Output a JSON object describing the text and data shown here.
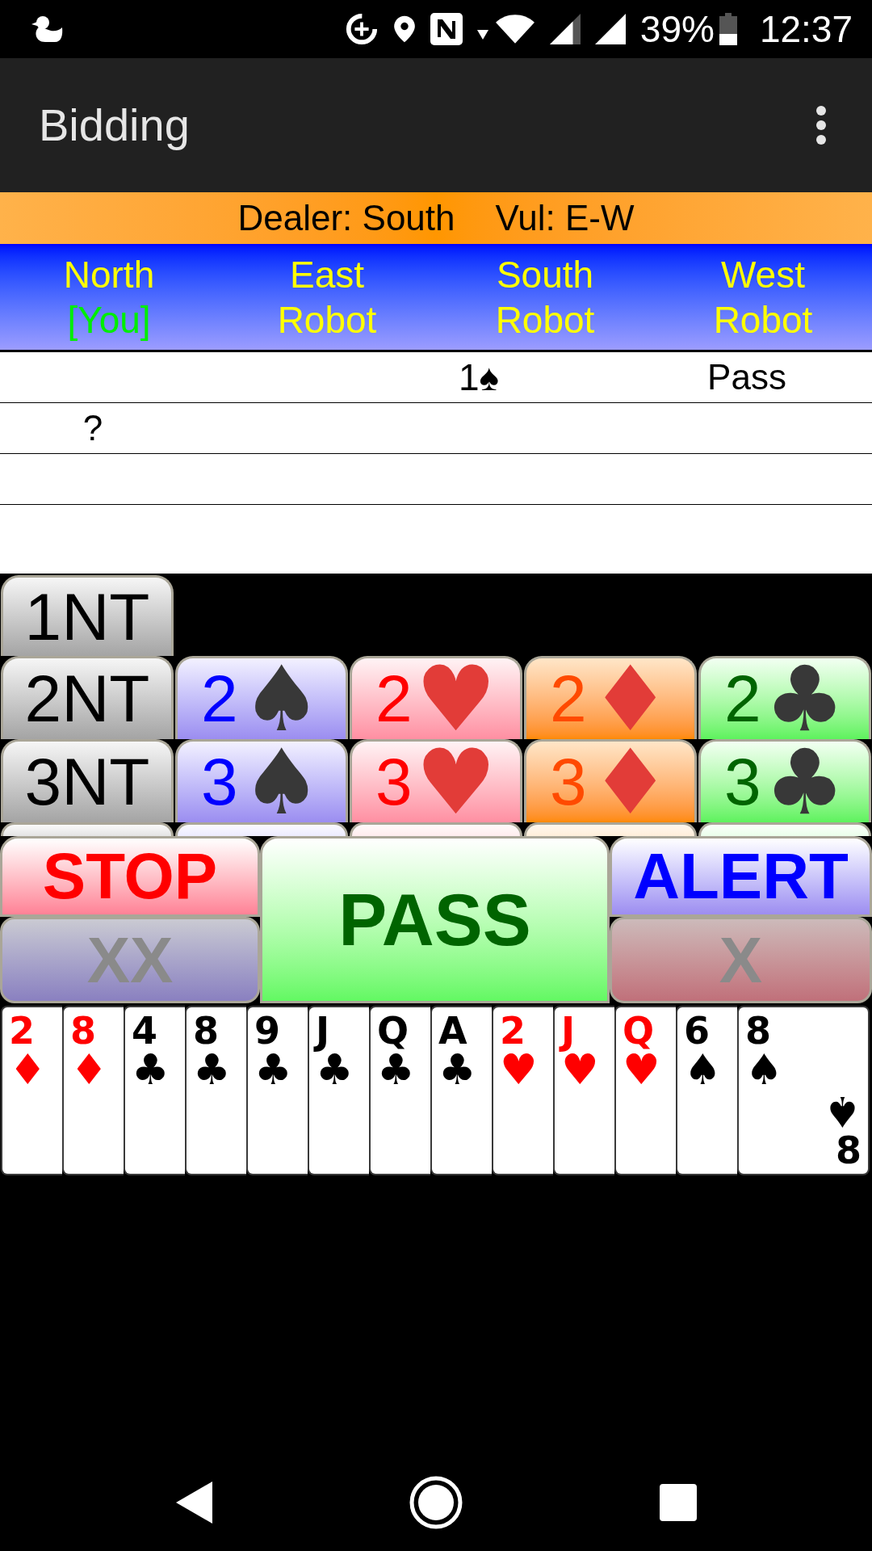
{
  "status_bar": {
    "battery_text": "39%",
    "time": "12:37"
  },
  "app_bar": {
    "title": "Bidding"
  },
  "deal_info": {
    "dealer": "Dealer: South",
    "vulnerability": "Vul: E-W"
  },
  "seats": [
    {
      "position": "North",
      "player": "[You]",
      "is_you": true
    },
    {
      "position": "East",
      "player": "Robot",
      "is_you": false
    },
    {
      "position": "South",
      "player": "Robot",
      "is_you": false
    },
    {
      "position": "West",
      "player": "Robot",
      "is_you": false
    }
  ],
  "auction": [
    {
      "cells": [
        {
          "kind": "empty"
        },
        {
          "kind": "empty"
        },
        {
          "kind": "bid",
          "text": "1♠"
        },
        {
          "kind": "call",
          "text": "Pass"
        }
      ]
    },
    {
      "cells": [
        {
          "kind": "prompt",
          "text": "?"
        },
        {
          "kind": "empty"
        },
        {
          "kind": "empty"
        },
        {
          "kind": "empty"
        }
      ]
    },
    {
      "cells": [
        {
          "kind": "empty"
        },
        {
          "kind": "empty"
        },
        {
          "kind": "empty"
        },
        {
          "kind": "empty"
        }
      ]
    },
    {
      "cells": [
        {
          "kind": "empty"
        },
        {
          "kind": "empty"
        },
        {
          "kind": "empty"
        },
        {
          "kind": "empty"
        }
      ]
    }
  ],
  "bid_rows": [
    [
      {
        "kind": "notrump",
        "level": "1",
        "label": "NT"
      }
    ],
    [
      {
        "kind": "notrump",
        "level": "2",
        "label": "NT"
      },
      {
        "kind": "spades",
        "level": "2",
        "suit": "♠"
      },
      {
        "kind": "hearts",
        "level": "2",
        "suit": "♥"
      },
      {
        "kind": "diamonds",
        "level": "2",
        "suit": "♦"
      },
      {
        "kind": "clubs",
        "level": "2",
        "suit": "♣"
      }
    ],
    [
      {
        "kind": "notrump",
        "level": "3",
        "label": "NT"
      },
      {
        "kind": "spades",
        "level": "3",
        "suit": "♠"
      },
      {
        "kind": "hearts",
        "level": "3",
        "suit": "♥"
      },
      {
        "kind": "diamonds",
        "level": "3",
        "suit": "♦"
      },
      {
        "kind": "clubs",
        "level": "3",
        "suit": "♣"
      }
    ]
  ],
  "covered_bid_row": [
    {
      "kind": "notrump"
    },
    {
      "kind": "spades"
    },
    {
      "kind": "hearts"
    },
    {
      "kind": "diamonds"
    },
    {
      "kind": "clubs"
    }
  ],
  "actions": {
    "stop": {
      "label": "STOP",
      "disabled": false
    },
    "redouble": {
      "label": "XX",
      "disabled": true
    },
    "pass": {
      "label": "PASS",
      "disabled": false
    },
    "alert": {
      "label": "ALERT",
      "disabled": false
    },
    "double": {
      "label": "X",
      "disabled": true
    }
  },
  "hand": [
    {
      "rank": "2",
      "suit": "♦",
      "color": "#ff0000"
    },
    {
      "rank": "8",
      "suit": "♦",
      "color": "#ff0000"
    },
    {
      "rank": "4",
      "suit": "♣",
      "color": "#000000"
    },
    {
      "rank": "8",
      "suit": "♣",
      "color": "#000000"
    },
    {
      "rank": "9",
      "suit": "♣",
      "color": "#000000"
    },
    {
      "rank": "J",
      "suit": "♣",
      "color": "#000000"
    },
    {
      "rank": "Q",
      "suit": "♣",
      "color": "#000000"
    },
    {
      "rank": "A",
      "suit": "♣",
      "color": "#000000"
    },
    {
      "rank": "2",
      "suit": "♥",
      "color": "#ff0000"
    },
    {
      "rank": "J",
      "suit": "♥",
      "color": "#ff0000"
    },
    {
      "rank": "Q",
      "suit": "♥",
      "color": "#ff0000"
    },
    {
      "rank": "6",
      "suit": "♠",
      "color": "#000000"
    },
    {
      "rank": "8",
      "suit": "♠",
      "color": "#000000",
      "bottom_suit": "♠",
      "bottom_rank": "8"
    }
  ]
}
